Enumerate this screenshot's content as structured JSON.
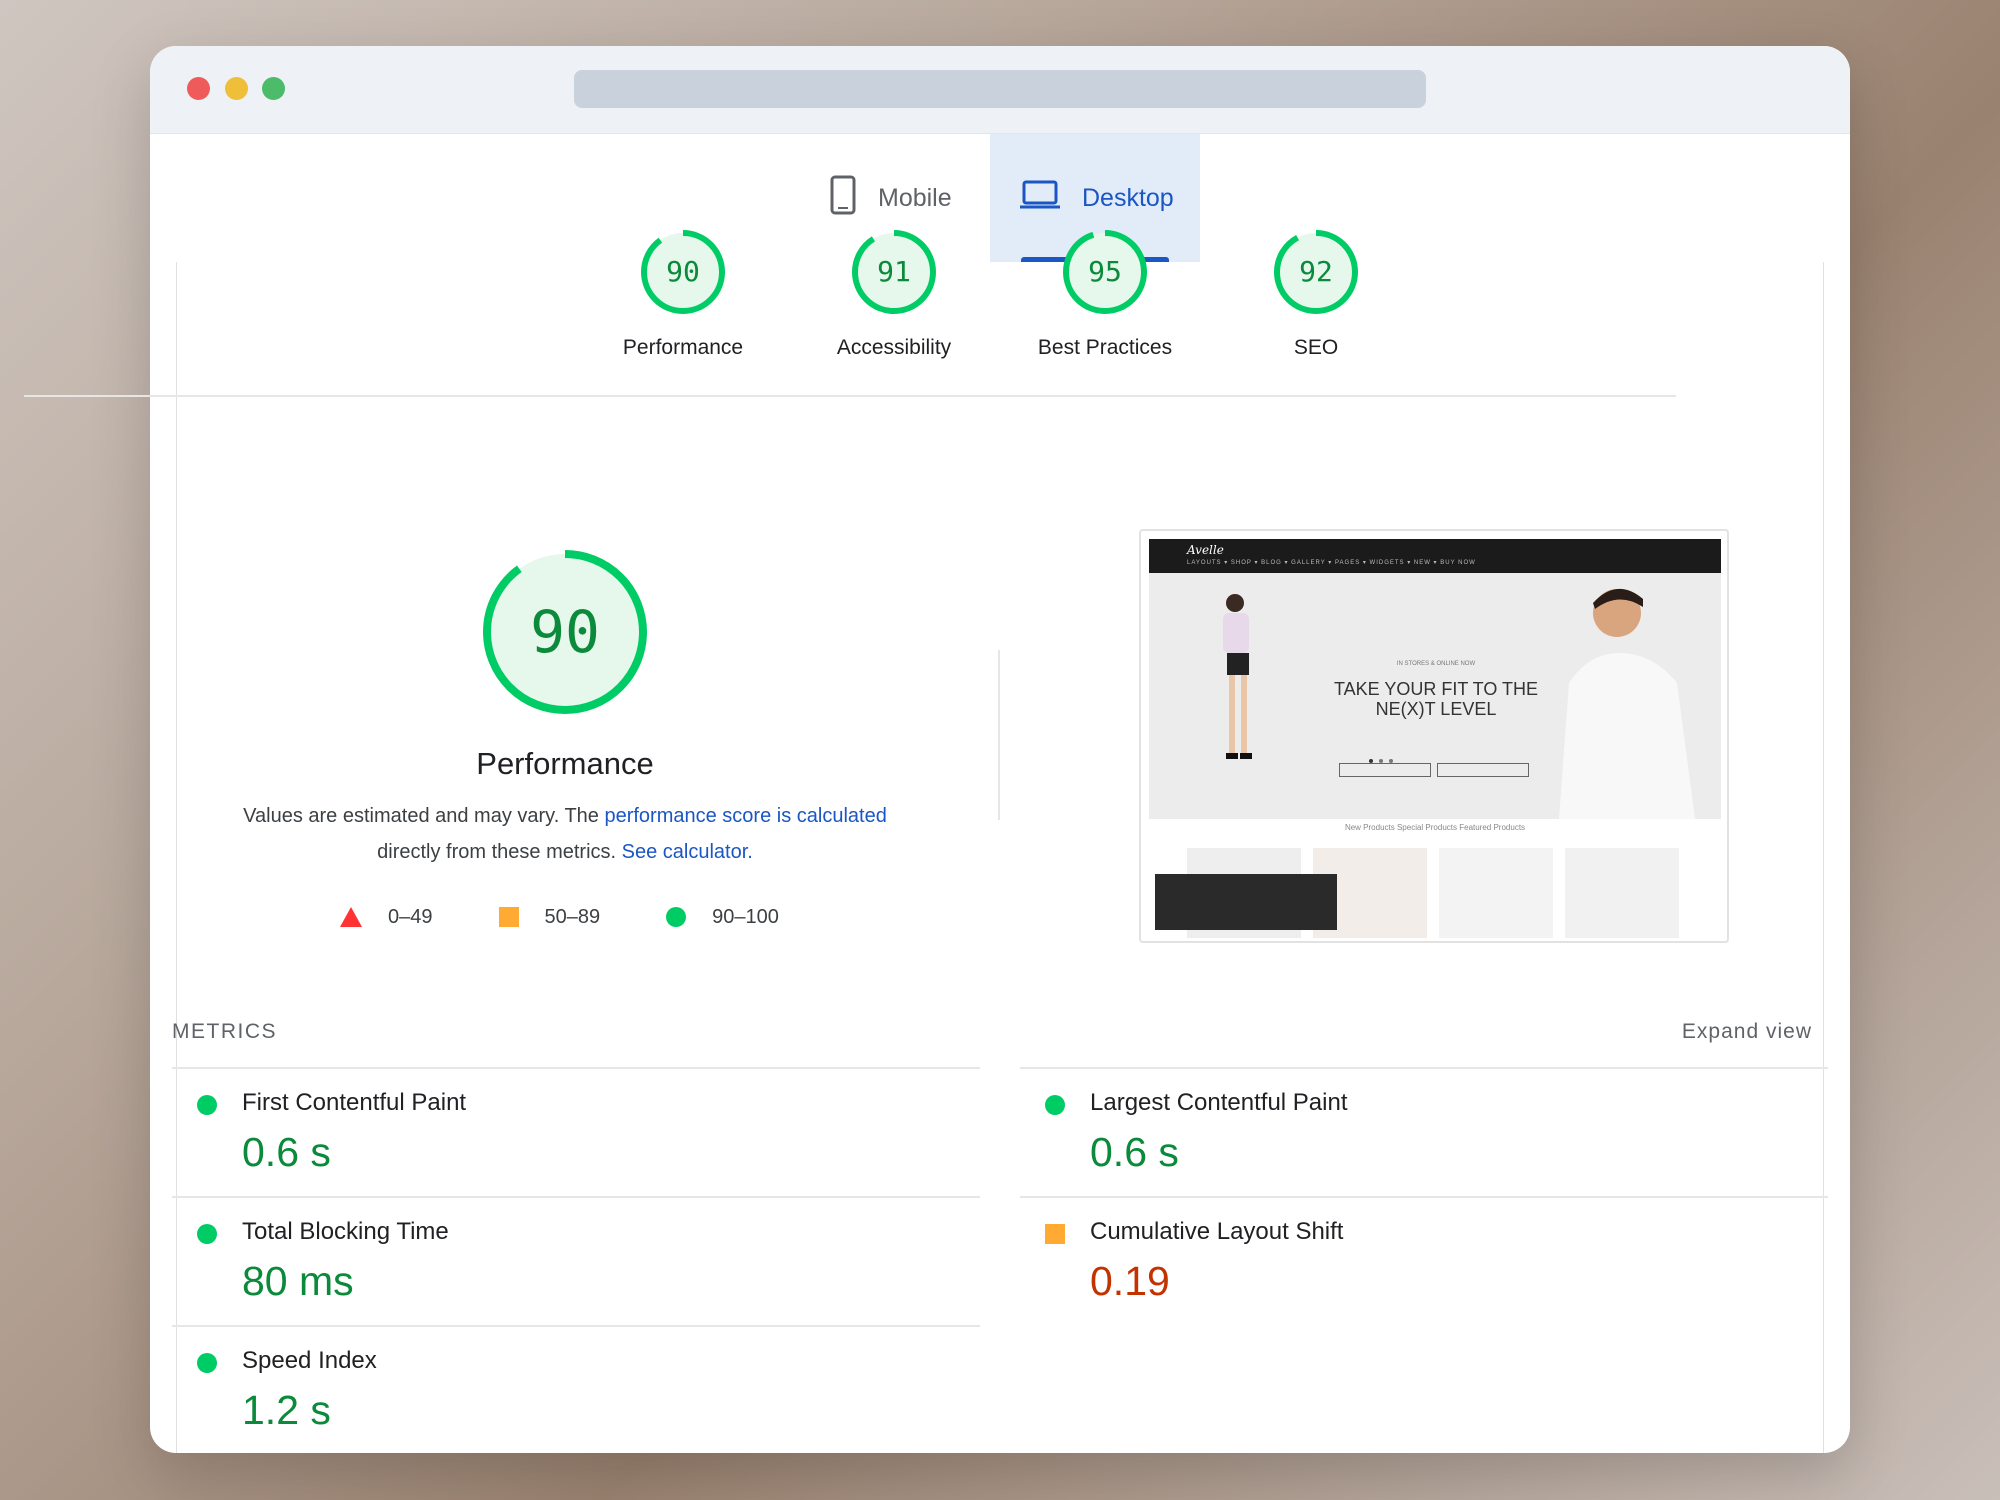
{
  "tabs": [
    {
      "label": "Mobile",
      "icon": "phone-icon",
      "selected": false
    },
    {
      "label": "Desktop",
      "icon": "laptop-icon",
      "selected": true
    }
  ],
  "categories": [
    {
      "score": "90",
      "label": "Performance"
    },
    {
      "score": "91",
      "label": "Accessibility"
    },
    {
      "score": "95",
      "label": "Best Practices"
    },
    {
      "score": "92",
      "label": "SEO"
    }
  ],
  "performance": {
    "score": "90",
    "title": "Performance",
    "desc_before": "Values are estimated and may vary. The ",
    "desc_link1": "performance score is calculated",
    "desc_middle": "directly from these metrics. ",
    "desc_link2": "See calculator."
  },
  "legend": [
    {
      "range": "0–49",
      "shape": "triangle",
      "color": "#ff3333"
    },
    {
      "range": "50–89",
      "shape": "square",
      "color": "#ffaa33"
    },
    {
      "range": "90–100",
      "shape": "circle",
      "color": "#00cc66"
    }
  ],
  "preview": {
    "logo": "Avelle",
    "menu": "LAYOUTS ▾  SHOP ▾  BLOG ▾  GALLERY ▾  PAGES ▾  WIDGETS ▾  NEW ▾  BUY NOW",
    "kicker": "IN STORES & ONLINE NOW",
    "headline_1": "TAKE YOUR FIT TO THE",
    "headline_2": "NE(X)T LEVEL",
    "product_tabs": "New Products     Special Products     Featured Products"
  },
  "metrics": {
    "heading": "METRICS",
    "expand_label": "Expand view",
    "items": [
      {
        "name": "First Contentful Paint",
        "value": "0.6 s",
        "status": "good"
      },
      {
        "name": "Largest Contentful Paint",
        "value": "0.6 s",
        "status": "good"
      },
      {
        "name": "Total Blocking Time",
        "value": "80 ms",
        "status": "good"
      },
      {
        "name": "Cumulative Layout Shift",
        "value": "0.19",
        "status": "average"
      },
      {
        "name": "Speed Index",
        "value": "1.2 s",
        "status": "good"
      }
    ]
  },
  "colors": {
    "good": "#0a8a3a",
    "good_marker": "#00cc66",
    "average_value": "#c33300",
    "average_marker": "#ffaa33",
    "accent": "#1a56c4"
  }
}
